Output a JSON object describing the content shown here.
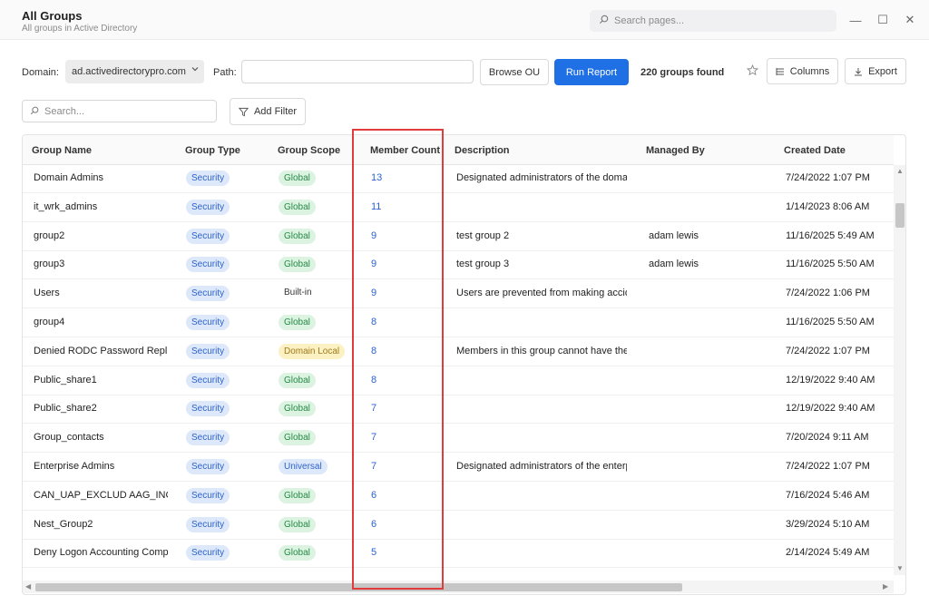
{
  "window": {
    "title": "All Groups",
    "subtitle": "All groups in Active Directory",
    "search_placeholder": "Search pages...",
    "minimize_glyph": "—",
    "maximize_glyph": "☐",
    "close_glyph": "✕"
  },
  "toolbar": {
    "domain_label": "Domain:",
    "domain_value": "ad.activedirectorypro.com",
    "path_label": "Path:",
    "path_value": "",
    "browse_ou_label": "Browse OU",
    "run_report_label": "Run Report",
    "result_count_text": "220 groups found",
    "columns_label": "Columns",
    "export_label": "Export"
  },
  "filters": {
    "search_placeholder": "Search...",
    "add_filter_label": "Add Filter"
  },
  "table": {
    "columns": [
      "Group Name",
      "Group Type",
      "Group Scope",
      "Member Count",
      "Description",
      "Managed By",
      "Created Date"
    ],
    "rows": [
      {
        "name": "Domain Admins",
        "type": "Security",
        "scope": "Global",
        "count": "13",
        "description": "Designated administrators of the domain",
        "managed_by": "",
        "created": "7/24/2022 1:07 PM"
      },
      {
        "name": "it_wrk_admins",
        "type": "Security",
        "scope": "Global",
        "count": "11",
        "description": "",
        "managed_by": "",
        "created": "1/14/2023 8:06 AM"
      },
      {
        "name": "group2",
        "type": "Security",
        "scope": "Global",
        "count": "9",
        "description": "test group 2",
        "managed_by": "adam lewis",
        "created": "11/16/2025 5:49 AM"
      },
      {
        "name": "group3",
        "type": "Security",
        "scope": "Global",
        "count": "9",
        "description": "test group 3",
        "managed_by": "adam lewis",
        "created": "11/16/2025 5:50 AM"
      },
      {
        "name": "Users",
        "type": "Security",
        "scope": "Built-in",
        "count": "9",
        "description": "Users are prevented from making accident",
        "managed_by": "",
        "created": "7/24/2022 1:06 PM"
      },
      {
        "name": "group4",
        "type": "Security",
        "scope": "Global",
        "count": "8",
        "description": "",
        "managed_by": "",
        "created": "11/16/2025 5:50 AM"
      },
      {
        "name": "Denied RODC Password Replicat",
        "type": "Security",
        "scope": "Domain Local",
        "count": "8",
        "description": "Members in this group cannot have their p",
        "managed_by": "",
        "created": "7/24/2022 1:07 PM"
      },
      {
        "name": "Public_share1",
        "type": "Security",
        "scope": "Global",
        "count": "8",
        "description": "",
        "managed_by": "",
        "created": "12/19/2022 9:40 AM"
      },
      {
        "name": "Public_share2",
        "type": "Security",
        "scope": "Global",
        "count": "7",
        "description": "",
        "managed_by": "",
        "created": "12/19/2022 9:40 AM"
      },
      {
        "name": "Group_contacts",
        "type": "Security",
        "scope": "Global",
        "count": "7",
        "description": "",
        "managed_by": "",
        "created": "7/20/2024 9:11 AM"
      },
      {
        "name": "Enterprise Admins",
        "type": "Security",
        "scope": "Universal",
        "count": "7",
        "description": "Designated administrators of the enterpris",
        "managed_by": "",
        "created": "7/24/2022 1:07 PM"
      },
      {
        "name": "CAN_UAP_EXCLUD AAG_INCLUD",
        "type": "Security",
        "scope": "Global",
        "count": "6",
        "description": "",
        "managed_by": "",
        "created": "7/16/2024 5:46 AM"
      },
      {
        "name": "Nest_Group2",
        "type": "Security",
        "scope": "Global",
        "count": "6",
        "description": "",
        "managed_by": "",
        "created": "3/29/2024 5:10 AM"
      },
      {
        "name": "Deny Logon Accounting Comput",
        "type": "Security",
        "scope": "Global",
        "count": "5",
        "description": "",
        "managed_by": "",
        "created": "2/14/2024 5:49 AM"
      }
    ]
  },
  "annotation": {
    "highlight_color": "#e03c3c"
  },
  "icons": {
    "search": "search-icon",
    "star": "star-icon",
    "columns": "columns-icon",
    "export": "download-icon",
    "filter": "filter-icon",
    "dropdown": "chevron-down-icon"
  },
  "colors": {
    "primary": "#1f6fe5",
    "security_pill": "#dde8fb",
    "global_pill": "#dcf3e2",
    "domain_local_pill": "#fbf1c2",
    "link_number": "#2a62d4"
  }
}
